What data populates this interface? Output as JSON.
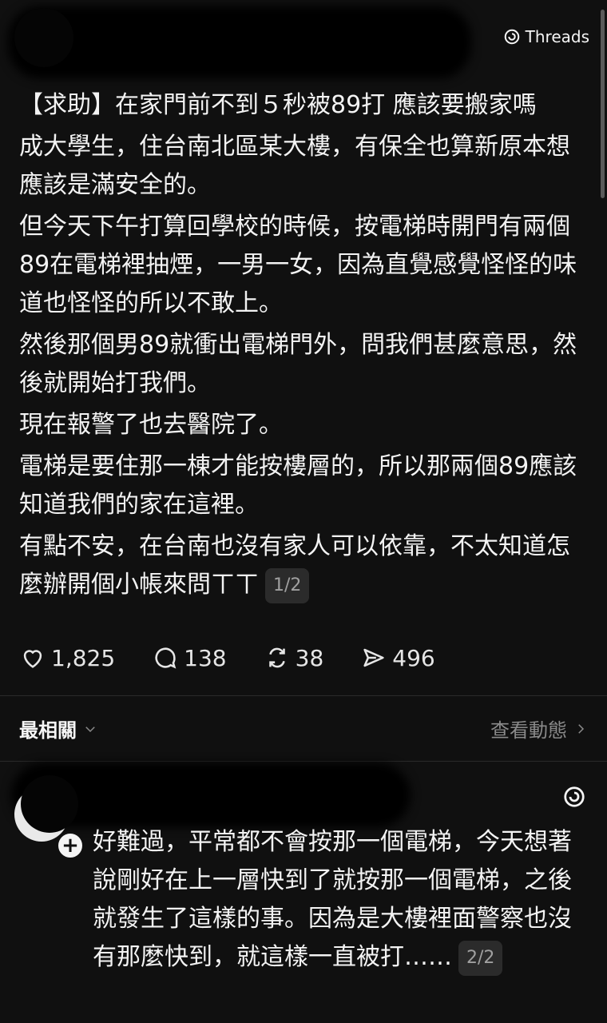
{
  "brand": {
    "name": "Threads",
    "icon": "threads-logo-icon"
  },
  "post": {
    "title": "【求助】在家門前不到５秒被89打 應該要搬家嗎",
    "paragraphs": [
      "成大學生，住台南北區某大樓，有保全也算新原本想應該是滿安全的。",
      "但今天下午打算回學校的時候，按電梯時開門有兩個89在電梯裡抽煙，一男一女，因為直覺感覺怪怪的味道也怪怪的所以不敢上。",
      "然後那個男89就衝出電梯門外，問我們甚麼意思，然後就開始打我們。",
      "現在報警了也去醫院了。",
      "電梯是要住那一棟才能按樓層的，所以那兩個89應該知道我們的家在這裡。",
      "有點不安，在台南也沒有家人可以依靠，不太知道怎麼辦開個小帳來問ㄒㄒ"
    ],
    "page_badge": "1/2",
    "stats": {
      "likes": "1,825",
      "comments": "138",
      "reposts": "38",
      "shares": "496"
    }
  },
  "sort": {
    "label": "最相關",
    "view_activity": "查看動態"
  },
  "reply": {
    "text": "好難過，平常都不會按那一個電梯，今天想著說剛好在上一層快到了就按那一個電梯，之後就發生了這樣的事。因為是大樓裡面警察也沒有那麼快到，就這樣一直被打……",
    "page_badge": "2/2"
  }
}
